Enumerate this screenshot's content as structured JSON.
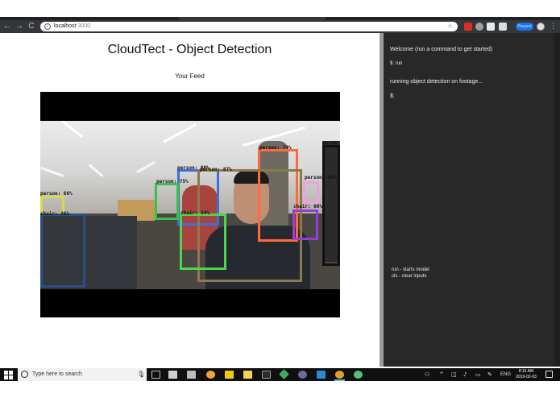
{
  "browser": {
    "url_host": "localhost",
    "url_port": ":3000",
    "profile_label": "Paused"
  },
  "page": {
    "title": "CloudTect - Object Detection",
    "feed_label": "Your Feed"
  },
  "detections": [
    {
      "label": "person: 74%",
      "color": "#ff6a3d"
    },
    {
      "label": "person: 80%",
      "color": "#3c6fd8"
    },
    {
      "label": "person: 87%",
      "color": "#8b7a4a"
    },
    {
      "label": "person: 75%",
      "color": "#39c24a"
    },
    {
      "label": "person: 66%",
      "color": "#d8d84a"
    },
    {
      "label": "chair: 46%",
      "color": "#2a4f86"
    },
    {
      "label": "chair: 54%",
      "color": "#4cd64c"
    },
    {
      "label": "person: 60%",
      "color": "#f0a0e0"
    },
    {
      "label": "chair: 60%",
      "color": "#9b3cd8"
    },
    {
      "label": "perso",
      "color": "#111111"
    }
  ],
  "terminal": {
    "welcome": "Welcome (run a command to get started)",
    "history_1": "$:  run",
    "output_1": "running object detection on footage...",
    "prompt": "$:",
    "help_run": "run - starts model",
    "help_cls": "cls - clear inputs"
  },
  "taskbar": {
    "search_placeholder": "Type here to search",
    "language": "ENG",
    "time": "8:16 AM",
    "date": "2019-02-03"
  }
}
